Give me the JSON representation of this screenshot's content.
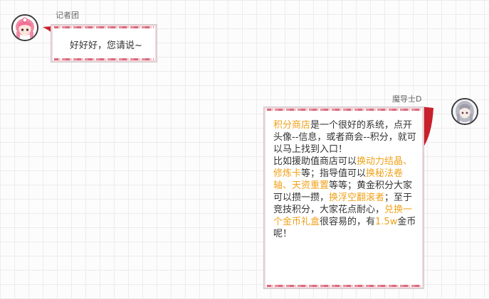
{
  "messages": [
    {
      "sender": "记者团",
      "side": "left",
      "avatar_icon": "pink-hair-girl-avatar-icon",
      "text": "好好好，您请说~"
    },
    {
      "sender": "魔导士D",
      "side": "right",
      "avatar_icon": "gray-hair-mage-avatar-icon",
      "segments": [
        {
          "t": "积分商店",
          "hl": true
        },
        {
          "t": "是一个很好的系统，点开头像--信息，或者商会--积分，就可以马上找到入口！",
          "hl": false
        },
        {
          "t": "\n",
          "hl": false
        },
        {
          "t": "比如援助值商店可以",
          "hl": false
        },
        {
          "t": "换动力结晶、修炼卡",
          "hl": true
        },
        {
          "t": "等；指导值可以",
          "hl": false
        },
        {
          "t": "换秘法卷轴、天资重置",
          "hl": true
        },
        {
          "t": "等等；黄金积分大家可以攒一攒，",
          "hl": false
        },
        {
          "t": "换浮空翻滚者",
          "hl": true
        },
        {
          "t": "；至于竞技积分，大家花点耐心，",
          "hl": false
        },
        {
          "t": "兑换一个金币礼盒",
          "hl": true
        },
        {
          "t": "很容易的，有",
          "hl": false
        },
        {
          "t": "1.5w",
          "hl": true
        },
        {
          "t": "金币呢！",
          "hl": false
        }
      ]
    }
  ],
  "colors": {
    "highlight": "#f0a21a",
    "bubble_border_accent": "#d96a7c",
    "tail": "#c8202c"
  }
}
